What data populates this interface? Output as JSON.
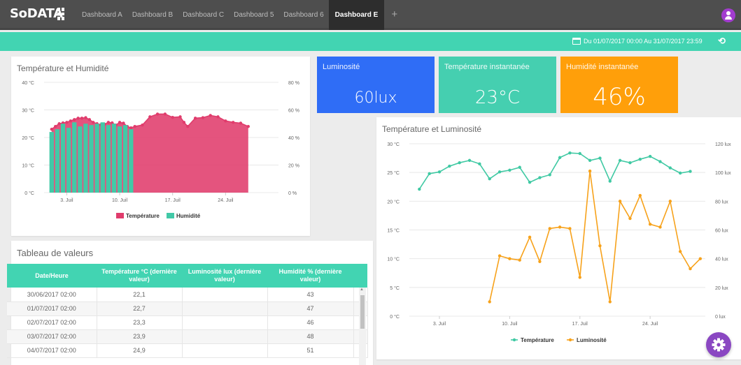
{
  "app": {
    "logo": "SoDATA"
  },
  "tabs": [
    {
      "label": "Dashboard A",
      "active": false
    },
    {
      "label": "Dashboard B",
      "active": false
    },
    {
      "label": "Dashboard C",
      "active": false
    },
    {
      "label": "Dashboard 5",
      "active": false
    },
    {
      "label": "Dashboard 6",
      "active": false
    },
    {
      "label": "Dashboard E",
      "active": true
    }
  ],
  "add_tab_label": "+",
  "datebar": {
    "range": "Du 01/07/2017 00:00 Au 31/07/2017 23:59",
    "refresh_icon": "refresh-icon"
  },
  "kpis": [
    {
      "label": "Luminosité",
      "value": "60lux",
      "color": "#2f6df6"
    },
    {
      "label": "Température instantanée",
      "value": "23°C",
      "color": "#45cfb0"
    },
    {
      "label": "Humidité instantanée",
      "value": "46%",
      "color": "#ff9f0a"
    }
  ],
  "chart1": {
    "title": "Température et Humidité"
  },
  "chart2": {
    "title": "Température et Luminosité"
  },
  "table": {
    "title": "Tableau de valeurs",
    "headers": [
      "Date/Heure",
      "Température °C (dernière valeur)",
      "Luminosité lux (dernière valeur)",
      "Humidité % (dernière valeur)"
    ],
    "rows": [
      [
        "30/06/2017 02:00",
        "22,1",
        "",
        "43"
      ],
      [
        "01/07/2017 02:00",
        "22,7",
        "",
        "47"
      ],
      [
        "02/07/2017 02:00",
        "23,3",
        "",
        "46"
      ],
      [
        "03/07/2017 02:00",
        "23,9",
        "",
        "48"
      ],
      [
        "04/07/2017 02:00",
        "24,9",
        "",
        "51"
      ]
    ]
  },
  "chart_data": [
    {
      "type": "area",
      "title": "Température et Humidité",
      "x_ticks": [
        "3. Juil",
        "10. Juil",
        "17. Juil",
        "24. Juil"
      ],
      "x_tick_days": [
        3,
        10,
        17,
        24
      ],
      "xlim": [
        0,
        31
      ],
      "y_left_ticks": [
        "0 °C",
        "10 °C",
        "20 °C",
        "30 °C",
        "40 °C"
      ],
      "y_right_ticks": [
        "0 %",
        "20 %",
        "40 %",
        "60 %",
        "80 %"
      ],
      "ylim_left": [
        0,
        40
      ],
      "ylim_right": [
        0,
        80
      ],
      "grid": true,
      "legend_position": "bottom",
      "series": [
        {
          "name": "Température",
          "type": "area",
          "color": "#e03c6c",
          "axis": "left",
          "x_days": [
            1,
            1.5,
            2,
            2.5,
            3,
            3.5,
            4,
            4.5,
            5,
            5.5,
            6,
            6.5,
            7,
            7.5,
            8,
            8.5,
            9,
            9.5,
            10,
            10.5,
            11,
            11.5,
            12,
            13,
            14,
            15,
            16,
            17,
            18,
            18.5,
            19,
            20,
            21,
            22,
            23,
            24,
            25,
            26,
            27
          ],
          "values": [
            23,
            24,
            25,
            25.3,
            25.5,
            26,
            26.5,
            27,
            27,
            27.2,
            26.5,
            25.5,
            25,
            24.6,
            24.8,
            25.5,
            25.3,
            24.5,
            25.5,
            25.2,
            24,
            23.5,
            24,
            24.5,
            27.5,
            28.5,
            28.5,
            27.3,
            27.5,
            25.5,
            24,
            27,
            27.2,
            28,
            27.5,
            26,
            25.5,
            25.2,
            24
          ]
        },
        {
          "name": "Humidité",
          "type": "bar",
          "color": "#42c9a7",
          "axis": "right",
          "x_days": [
            1,
            1.75,
            2.5,
            3.25,
            4,
            4.75,
            5.5,
            6.25,
            7,
            7.75,
            8.5,
            9.25,
            10,
            10.75,
            11.5
          ],
          "values": [
            44,
            46,
            50,
            47,
            51,
            48,
            50,
            49,
            50,
            51,
            49,
            50,
            48,
            49,
            46
          ]
        }
      ]
    },
    {
      "type": "line",
      "title": "Température et Luminosité",
      "x_ticks": [
        "3. Juil",
        "10. Juil",
        "17. Juil",
        "24. Juil"
      ],
      "x_tick_days": [
        3,
        10,
        17,
        24
      ],
      "xlim": [
        0,
        29.5
      ],
      "y_left_ticks": [
        "0 °C",
        "5 °C",
        "10 °C",
        "15 °C",
        "20 °C",
        "25 °C",
        "30 °C"
      ],
      "y_right_ticks": [
        "0 lux",
        "20 lux",
        "40 lux",
        "60 lux",
        "80 lux",
        "100 lux",
        "120 lux"
      ],
      "ylim_left": [
        0,
        30
      ],
      "ylim_right": [
        0,
        120
      ],
      "grid": true,
      "legend_position": "bottom",
      "series": [
        {
          "name": "Température",
          "color": "#3fc9a3",
          "axis": "left",
          "x_days": [
            1,
            2,
            3,
            4,
            5,
            6,
            7,
            8,
            9,
            10,
            11,
            12,
            13,
            14,
            15,
            16,
            17,
            18,
            19,
            20,
            21,
            22,
            23,
            24,
            25,
            26,
            27,
            28
          ],
          "values": [
            22.1,
            24.8,
            25.1,
            26.1,
            26.7,
            27.1,
            26.5,
            23.9,
            25.1,
            25.4,
            25.9,
            23.3,
            24.1,
            24.6,
            27.6,
            28.4,
            28.3,
            27.1,
            27.5,
            23.5,
            27.1,
            26.7,
            27.3,
            27.8,
            26.9,
            25.8,
            24.9,
            25.2
          ]
        },
        {
          "name": "Luminosité",
          "color": "#f7a21b",
          "axis": "right",
          "x_days": [
            8,
            9,
            10,
            11,
            12,
            13,
            14,
            15,
            16,
            17,
            18,
            19,
            20,
            21,
            22,
            23,
            24,
            25,
            26,
            27,
            28,
            29
          ],
          "values": [
            10,
            42,
            40,
            39,
            55,
            38,
            61,
            62,
            61,
            27,
            101,
            49,
            10,
            80,
            68,
            84,
            64,
            62,
            80,
            45,
            33,
            40
          ]
        }
      ]
    }
  ]
}
